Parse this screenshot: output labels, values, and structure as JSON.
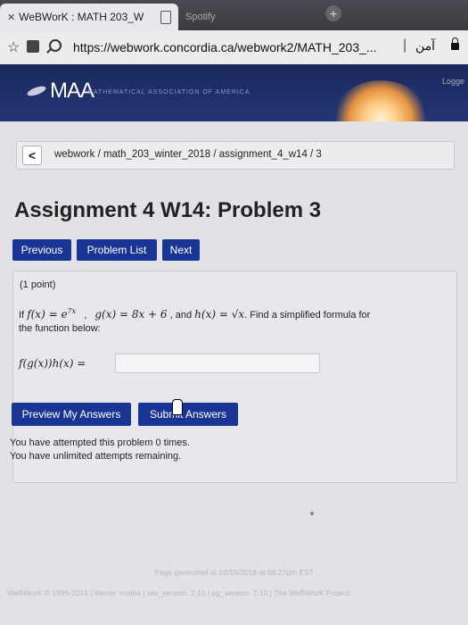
{
  "browser": {
    "active_tab": {
      "title": "WeBWorK : MATH 203_W"
    },
    "inactive_tab": {
      "title": "Spotify"
    },
    "url": "https://webwork.concordia.ca/webwork2/MATH_203_...",
    "right_text": "آمن"
  },
  "banner": {
    "logo": "MAA",
    "subtitle": "MATHEMATICAL ASSOCIATION OF AMERICA",
    "logged": "Logge"
  },
  "breadcrumb": {
    "back_label": "<",
    "text": "webwork / math_203_winter_2018 / assignment_4_w14 / 3"
  },
  "page_title": "Assignment 4 W14: Problem 3",
  "nav": {
    "previous": "Previous",
    "problem_list": "Problem List",
    "next": "Next"
  },
  "problem": {
    "points": "(1 point)",
    "if_word": "If",
    "f_def": "f(x) = e",
    "f_exp": "7x",
    "comma": ",",
    "g_def": "g(x) = 8x + 6",
    "and_word": ", and",
    "h_def": "h(x) = √x",
    "find_text": ". Find a simplified formula for",
    "line2": "the function below:",
    "expression": "f(g(x))h(x) =",
    "answer_value": ""
  },
  "actions": {
    "preview": "Preview My Answers",
    "submit": "Submit Answers"
  },
  "messages": {
    "attempted": "You have attempted this problem 0 times.",
    "remaining": "You have unlimited attempts remaining."
  },
  "footer": {
    "generated": "Page generated at 02/15/2018 at 08:27pm EST",
    "versions": "WeBWorK © 1996-2015 | theme: math4 | ww_version: 2.10 | pg_version: 2.10 | The WeBWorK Project"
  }
}
